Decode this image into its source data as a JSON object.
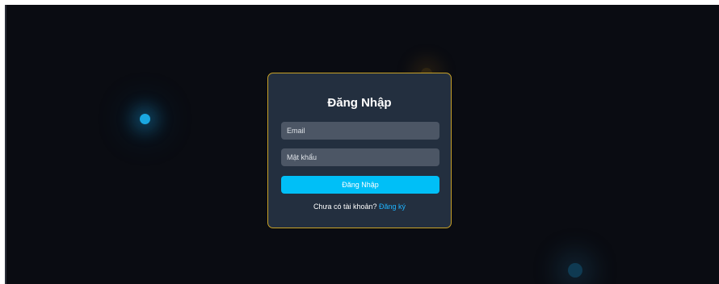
{
  "login": {
    "title": "Đăng Nhập",
    "email_placeholder": "Email",
    "password_placeholder": "Mật khẩu",
    "submit_label": "Đăng Nhập",
    "register_prompt": "Chưa có tài khoản?",
    "register_link": "Đăng ký"
  },
  "colors": {
    "background": "#0a0c12",
    "card": "#232f3f",
    "card_border": "#c9a227",
    "input": "#4c5665",
    "accent": "#00bff7",
    "link": "#1fb4ff"
  }
}
